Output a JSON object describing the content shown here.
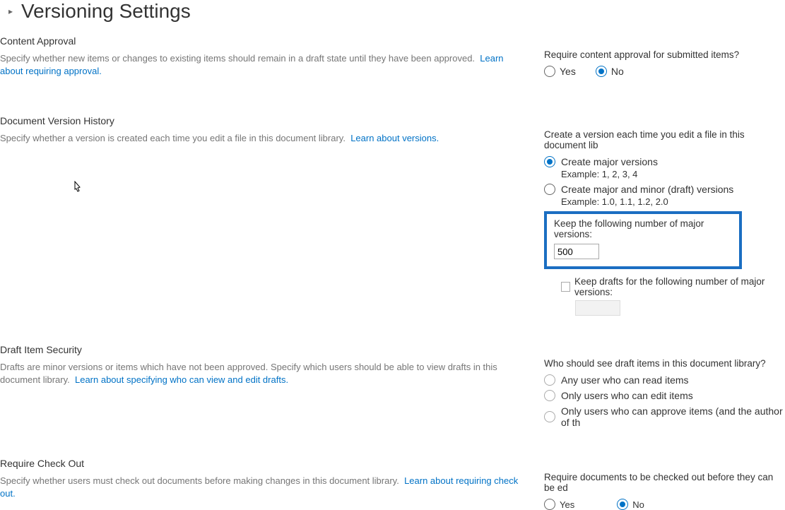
{
  "page": {
    "title": "Versioning Settings"
  },
  "contentApproval": {
    "heading": "Content Approval",
    "desc": "Specify whether new items or changes to existing items should remain in a draft state until they have been approved.",
    "link": "Learn about requiring approval.",
    "question": "Require content approval for submitted items?",
    "yes": "Yes",
    "no": "No"
  },
  "versionHistory": {
    "heading": "Document Version History",
    "desc": "Specify whether a version is created each time you edit a file in this document library.",
    "link": "Learn about versions.",
    "question": "Create a version each time you edit a file in this document lib",
    "optMajor": "Create major versions",
    "exMajor": "Example: 1, 2, 3, 4",
    "optMinor": "Create major and minor (draft) versions",
    "exMinor": "Example: 1.0, 1.1, 1.2, 2.0",
    "keepMajorLabel": "Keep the following number of major versions:",
    "keepMajorValue": "500",
    "keepDraftsLabel": "Keep drafts for the following number of major versions:"
  },
  "draftSecurity": {
    "heading": "Draft Item Security",
    "desc": "Drafts are minor versions or items which have not been approved. Specify which users should be able to view drafts in this document library.",
    "link": "Learn about specifying who can view and edit drafts.",
    "question": "Who should see draft items in this document library?",
    "optAny": "Any user who can read items",
    "optEdit": "Only users who can edit items",
    "optApprove": "Only users who can approve items (and the author of th"
  },
  "checkOut": {
    "heading": "Require Check Out",
    "desc": "Specify whether users must check out documents before making changes in this document library.",
    "link": "Learn about requiring check out.",
    "question": "Require documents to be checked out before they can be ed",
    "yes": "Yes",
    "no": "No"
  }
}
